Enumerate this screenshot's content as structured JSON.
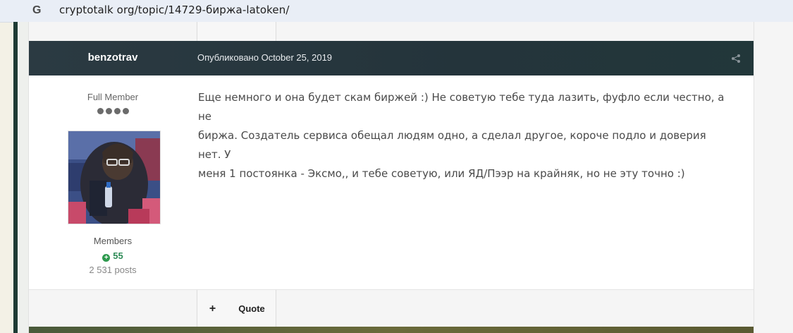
{
  "browser": {
    "url": "cryptotalk org/topic/14729-биржа-latoken/"
  },
  "post": {
    "author": "benzotrav",
    "published": "Опубликовано October 25, 2019",
    "rank": "Full Member",
    "group": "Members",
    "reputation": "55",
    "posts": "2 531 posts",
    "content_line1": "Еще немного и она будет скам биржей :) Не советую тебе туда лазить, фуфло если честно, а не",
    "content_line2": "биржа. Создатель сервиса обещал людям одно, а сделал другое, короче подло и доверия нет. У",
    "content_line3": "меня 1 постоянка - Эксмо,, и тебе советую, или ЯД/Пээр на крайняк, но не эту точно :)"
  },
  "footer": {
    "plus_label": "+",
    "quote_label": "Quote"
  },
  "colors": {
    "header_bg": "#2b3a42",
    "reputation_green": "#2e9a4e"
  }
}
